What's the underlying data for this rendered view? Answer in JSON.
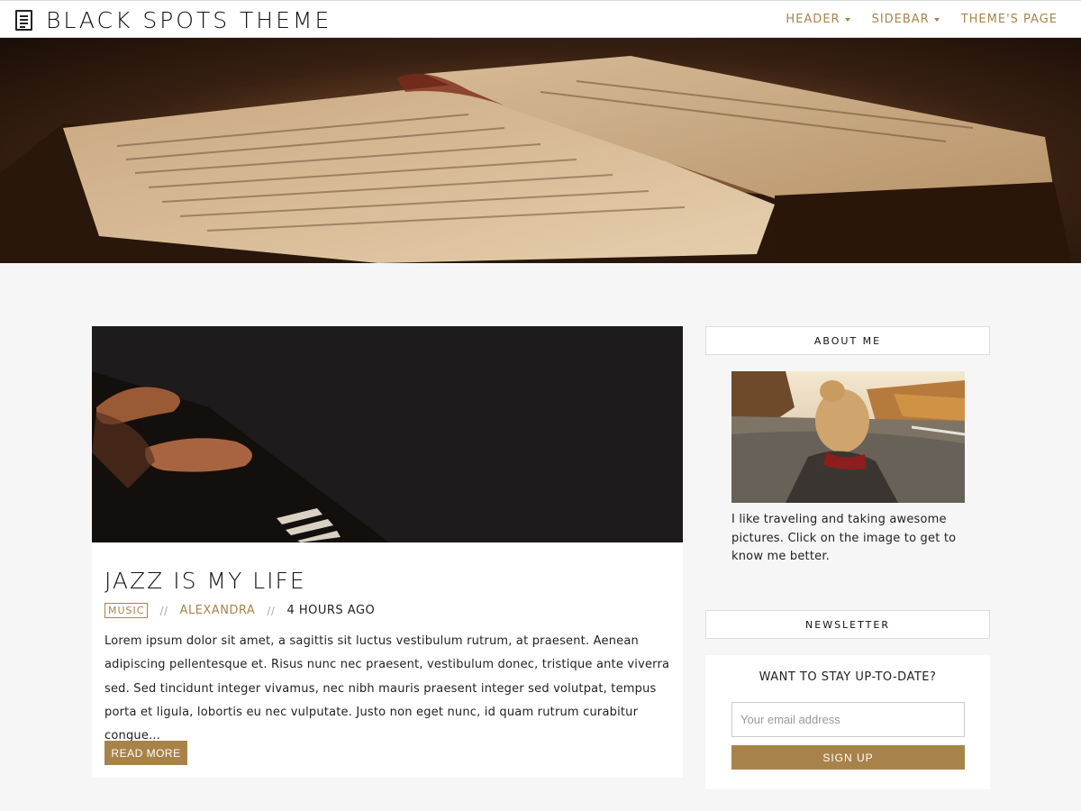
{
  "site": {
    "title": "BLACK SPOTS THEME",
    "logo_icon": "document-icon"
  },
  "nav": {
    "items": [
      {
        "label": "HEADER",
        "has_dropdown": true
      },
      {
        "label": "SIDEBAR",
        "has_dropdown": true
      },
      {
        "label": "THEME'S PAGE",
        "has_dropdown": false
      }
    ]
  },
  "post": {
    "title": "JAZZ IS MY LIFE",
    "category": "MUSIC",
    "separator": "//",
    "author": "ALEXANDRA",
    "time": "4 HOURS AGO",
    "excerpt": "Lorem ipsum dolor sit amet, a sagittis sit luctus vestibulum rutrum, at praesent. Aenean adipiscing pellentesque et. Risus nunc nec praesent, vestibulum donec, tristique ante viverra sed. Sed tincidunt integer vivamus, nec nibh mauris praesent integer sed volutpat, tempus porta et ligula, lobortis eu nec vulputate. Justo non eget nunc, id quam rutrum curabitur congue…",
    "read_more_label": "READ MORE"
  },
  "sidebar": {
    "about": {
      "heading": "ABOUT ME",
      "text": "I like traveling and taking awesome pictures. Click on the image to get to know me better."
    },
    "newsletter": {
      "heading": "NEWSLETTER",
      "title": "WANT TO STAY UP-TO-DATE?",
      "input_placeholder": "Your email address",
      "input_value": "",
      "button_label": "SIGN UP"
    }
  },
  "colors": {
    "accent": "#a88349",
    "background": "#f6f6f6",
    "card": "#ffffff",
    "text": "#222222"
  }
}
